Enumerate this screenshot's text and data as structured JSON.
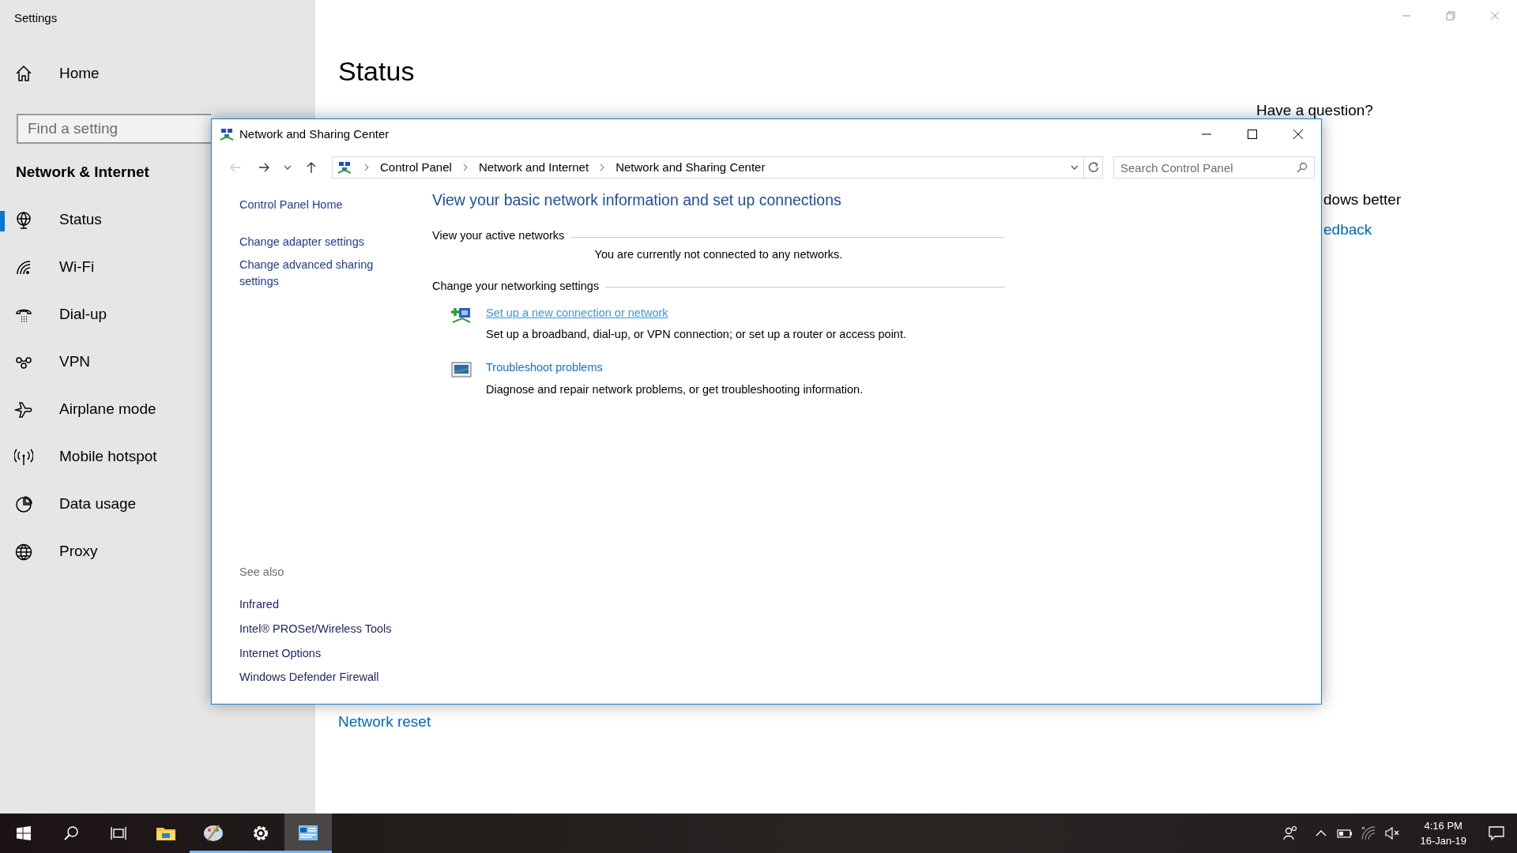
{
  "settings": {
    "title": "Settings",
    "home": "Home",
    "search": {
      "placeholder": "Find a setting"
    },
    "section": "Network & Internet",
    "nav": [
      {
        "kind": "globe-stand",
        "label": "Status",
        "selected": true
      },
      {
        "kind": "wifi",
        "label": "Wi-Fi",
        "selected": false
      },
      {
        "kind": "phone",
        "label": "Dial-up",
        "selected": false
      },
      {
        "kind": "vpn",
        "label": "VPN",
        "selected": false
      },
      {
        "kind": "plane",
        "label": "Airplane mode",
        "selected": false
      },
      {
        "kind": "antenna",
        "label": "Mobile hotspot",
        "selected": false
      },
      {
        "kind": "pie",
        "label": "Data usage",
        "selected": false
      },
      {
        "kind": "globe",
        "label": "Proxy",
        "selected": false
      }
    ],
    "page": {
      "title": "Status",
      "help_heading": "Have a question?",
      "feedback_text": "dows better",
      "feedback_link": "edback",
      "network_reset": "Network reset"
    }
  },
  "control_panel": {
    "title": "Network and Sharing Center",
    "breadcrumb": [
      "Control Panel",
      "Network and Internet",
      "Network and Sharing Center"
    ],
    "search": {
      "placeholder": "Search Control Panel"
    },
    "sidebar_links": [
      "Control Panel Home",
      "Change adapter settings",
      "Change advanced sharing settings"
    ],
    "see_also_heading": "See also",
    "see_also": [
      "Infrared",
      "Intel® PROSet/Wireless Tools",
      "Internet Options",
      "Windows Defender Firewall"
    ],
    "heading": "View your basic network information and set up connections",
    "active_networks_label": "View your active networks",
    "active_networks_message": "You are currently not connected to any networks.",
    "change_settings_label": "Change your networking settings",
    "tasks": [
      {
        "kind": "new-connection",
        "link": "Set up a new connection or network",
        "hovered": true,
        "description": "Set up a broadband, dial-up, or VPN connection; or set up a router or access point."
      },
      {
        "kind": "troubleshoot",
        "link": "Troubleshoot problems",
        "hovered": false,
        "description": "Diagnose and repair network problems, or get troubleshooting information."
      }
    ]
  },
  "taskbar": {
    "apps": [
      {
        "kind": "explorer",
        "running": false,
        "active": false
      },
      {
        "kind": "paint",
        "running": true,
        "active": false
      },
      {
        "kind": "settings",
        "running": true,
        "active": false
      },
      {
        "kind": "control-panel",
        "running": true,
        "active": true
      }
    ],
    "clock": {
      "time": "4:16 PM",
      "date": "16-Jan-19"
    }
  }
}
